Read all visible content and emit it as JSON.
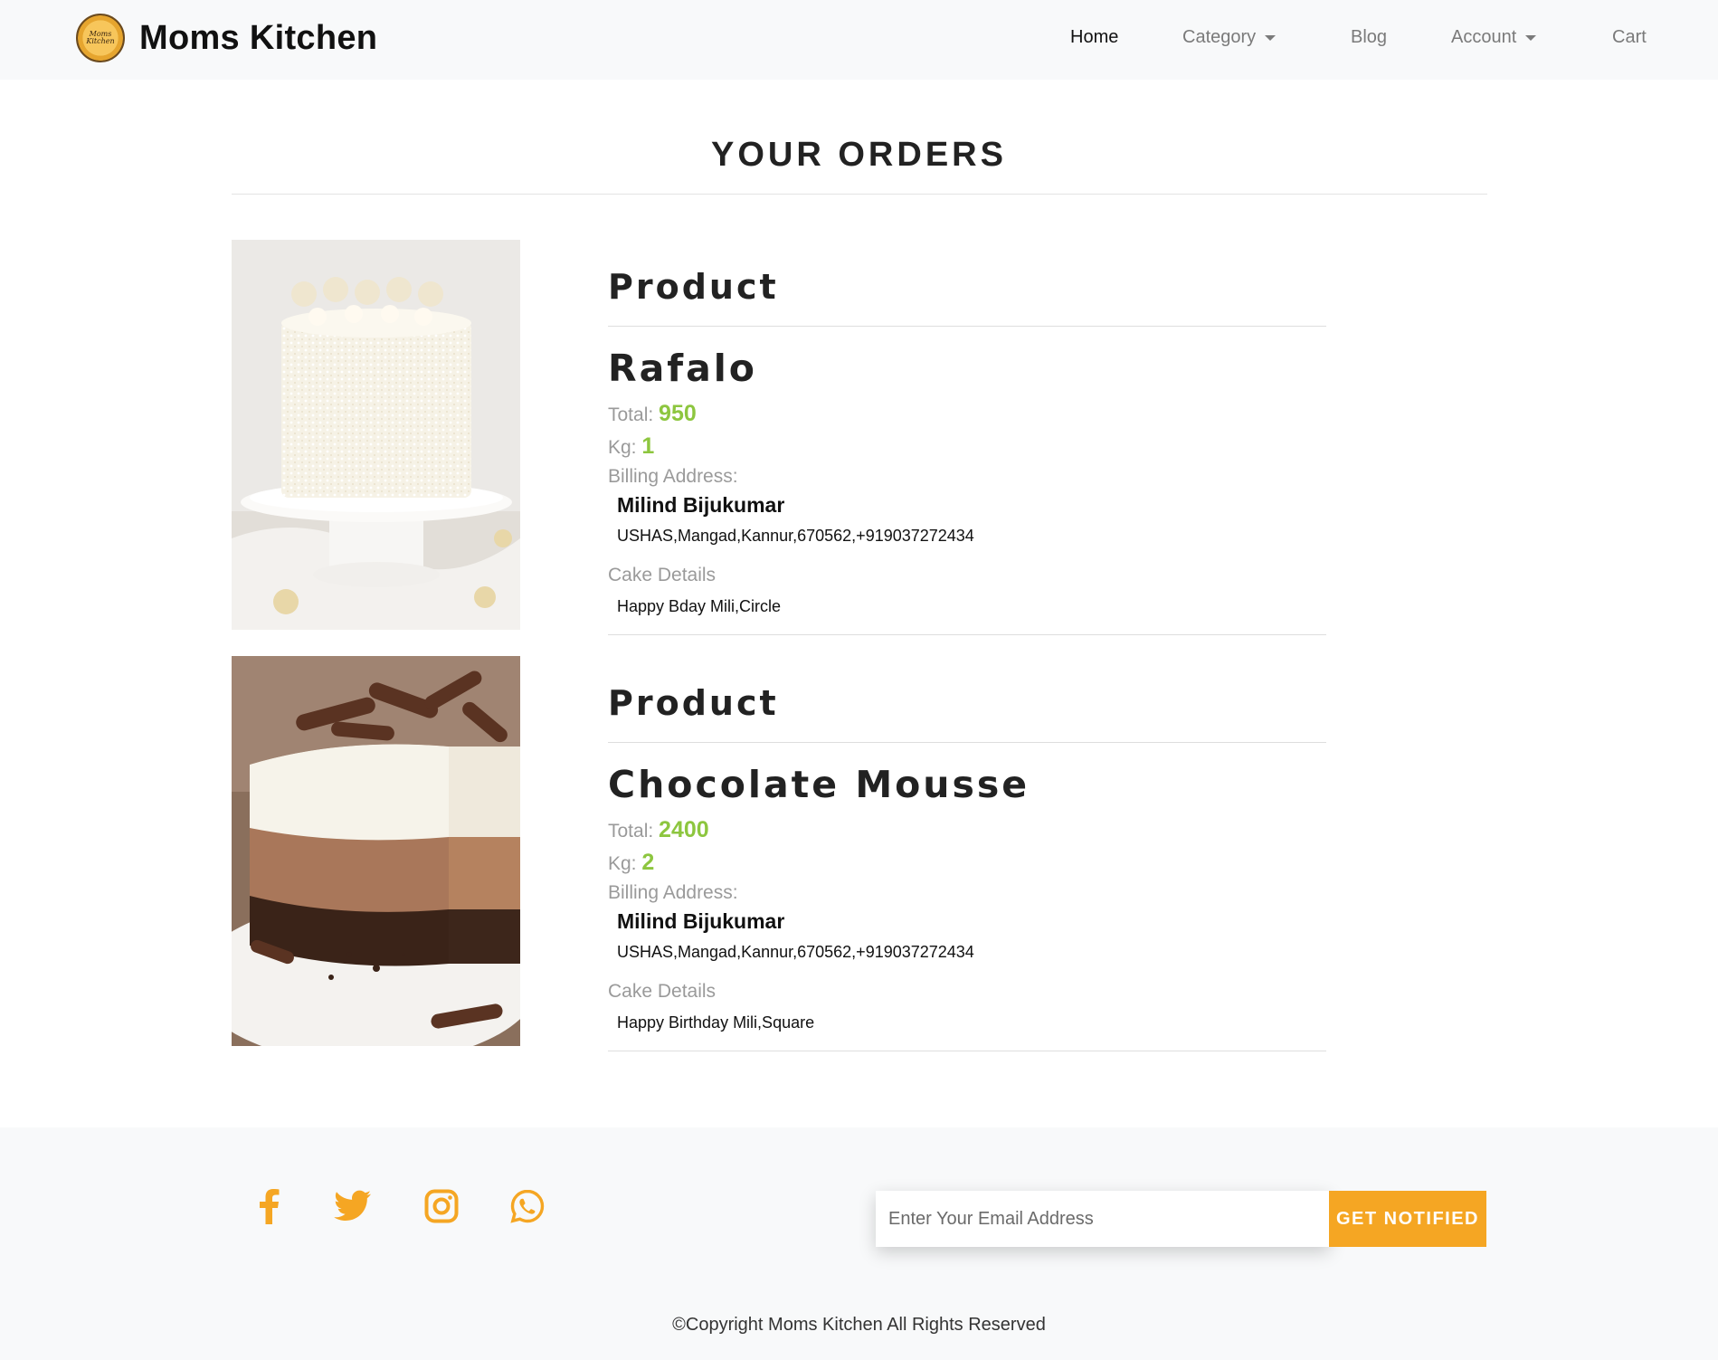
{
  "navbar": {
    "brand": "Moms Kitchen",
    "logo_text": "Moms Kitchen",
    "items": [
      {
        "label": "Home",
        "active": true,
        "dropdown": false
      },
      {
        "label": "Category",
        "active": false,
        "dropdown": true
      },
      {
        "label": "Blog",
        "active": false,
        "dropdown": false
      },
      {
        "label": "Account",
        "active": false,
        "dropdown": true
      },
      {
        "label": "Cart",
        "active": false,
        "dropdown": false
      }
    ]
  },
  "page": {
    "title": "YOUR ORDERS"
  },
  "labels": {
    "product_heading": "Product",
    "total": "Total:",
    "kg": "Kg:",
    "billing": "Billing Address:",
    "cake_details": "Cake Details"
  },
  "orders": [
    {
      "product_name": "Rafalo",
      "total": "950",
      "kg": "1",
      "billing_name": "Milind Bijukumar",
      "billing_address": "USHAS,Mangad,Kannur,670562,+919037272434",
      "cake_details": "Happy Bday Mili,Circle"
    },
    {
      "product_name": "Chocolate Mousse",
      "total": "2400",
      "kg": "2",
      "billing_name": "Milind Bijukumar",
      "billing_address": "USHAS,Mangad,Kannur,670562,+919037272434",
      "cake_details": "Happy Birthday Mili,Square"
    }
  ],
  "footer": {
    "social_icons": [
      "facebook-icon",
      "twitter-icon",
      "instagram-icon",
      "whatsapp-icon"
    ],
    "email_placeholder": "Enter Your Email Address",
    "notify_label": "GET NOTIFIED",
    "copyright": "©Copyright Moms Kitchen All Rights Reserved"
  },
  "colors": {
    "accent_orange": "#f5a623",
    "value_green": "#8dc63f",
    "navbar_bg": "#f8f9fa"
  }
}
